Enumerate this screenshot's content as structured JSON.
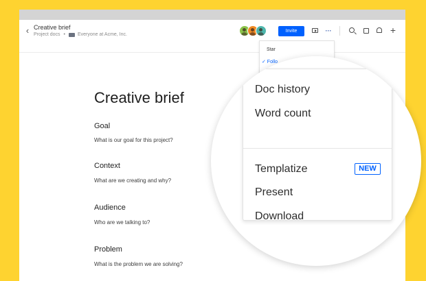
{
  "header": {
    "doc_title": "Creative brief",
    "breadcrumb_folder": "Project docs",
    "breadcrumb_separator": "•",
    "sharing": "Everyone at Acme, Inc.",
    "invite_label": "Invite",
    "back_glyph": "‹",
    "more_glyph": "···",
    "plus_glyph": "+"
  },
  "avatars": [
    {
      "color": "#8bc34a"
    },
    {
      "color": "#f08a24"
    },
    {
      "color": "#4db6ac"
    }
  ],
  "small_menu": {
    "items": [
      "Star",
      "✓ Follo"
    ]
  },
  "document": {
    "title": "Creative brief",
    "sections": [
      {
        "heading": "Goal",
        "question": "What is our goal for this project?"
      },
      {
        "heading": "Context",
        "question": "What are we creating and why?"
      },
      {
        "heading": "Audience",
        "question": "Who are we talking to?"
      },
      {
        "heading": "Problem",
        "question": "What is the problem we are solving?"
      }
    ]
  },
  "big_menu": {
    "items": [
      "Doc history",
      "Word count",
      "Templatize",
      "Present",
      "Download"
    ],
    "new_badge": "NEW"
  },
  "colors": {
    "background": "#fed330",
    "accent": "#0061fe"
  }
}
